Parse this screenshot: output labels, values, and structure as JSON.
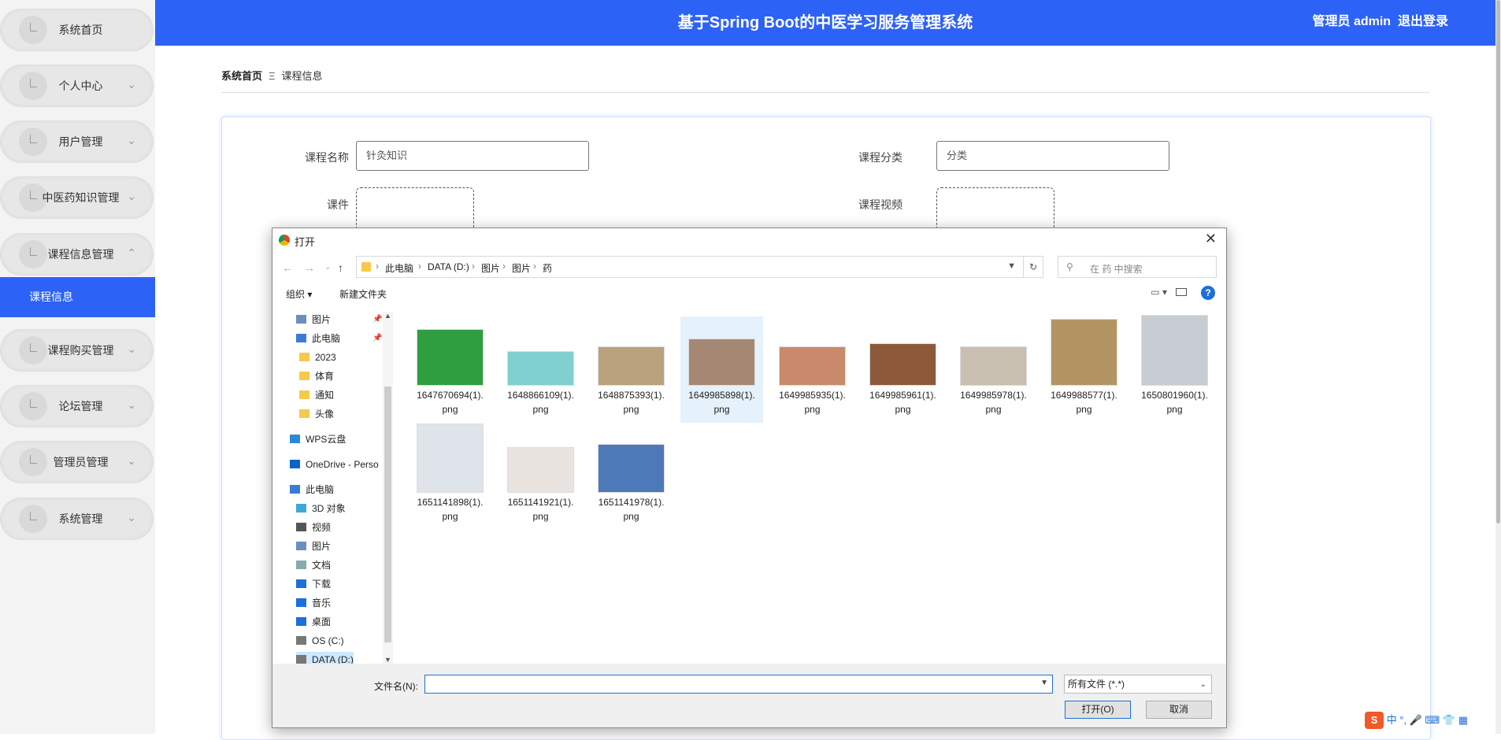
{
  "header": {
    "title": "基于Spring Boot的中医学习服务管理系统",
    "user": "管理员 admin",
    "logout": "退出登录"
  },
  "sidebar": {
    "items": [
      {
        "label": "系统首页",
        "has_chevron": false
      },
      {
        "label": "个人中心",
        "has_chevron": true
      },
      {
        "label": "用户管理",
        "has_chevron": true
      },
      {
        "label": "中医药知识管理",
        "has_chevron": true
      },
      {
        "label": "课程信息管理",
        "has_chevron": true,
        "expanded": true
      },
      {
        "label": "课程购买管理",
        "has_chevron": true
      },
      {
        "label": "论坛管理",
        "has_chevron": true
      },
      {
        "label": "管理员管理",
        "has_chevron": true
      },
      {
        "label": "系统管理",
        "has_chevron": true
      }
    ],
    "active_sub": "课程信息"
  },
  "breadcrumb": {
    "home": "系统首页",
    "separator": "Ξ",
    "current": "课程信息"
  },
  "form": {
    "course_name_label": "课程名称",
    "course_name_value": "针灸知识",
    "category_label": "课程分类",
    "category_value": "分类",
    "courseware_label": "课件",
    "video_label": "课程视频"
  },
  "dialog": {
    "title": "打开",
    "path": [
      "此电脑",
      "DATA (D:)",
      "图片",
      "图片",
      "药"
    ],
    "search_placeholder": "在 药 中搜索",
    "organize": "组织 ▾",
    "new_folder": "新建文件夹",
    "tree": [
      {
        "label": "图片",
        "icon": "pictures-icon",
        "pinned": true
      },
      {
        "label": "此电脑",
        "icon": "pc-icon",
        "pinned": true
      },
      {
        "label": "2023",
        "icon": "folder-icon"
      },
      {
        "label": "体育",
        "icon": "folder-icon"
      },
      {
        "label": "通知",
        "icon": "folder-icon"
      },
      {
        "label": "头像",
        "icon": "folder-icon"
      },
      {
        "label": "WPS云盘",
        "icon": "cloud-icon"
      },
      {
        "label": "OneDrive - Perso",
        "icon": "onedrive-icon"
      },
      {
        "label": "此电脑",
        "icon": "pc-icon"
      },
      {
        "label": "3D 对象",
        "icon": "3d-objects-icon"
      },
      {
        "label": "视频",
        "icon": "videos-icon"
      },
      {
        "label": "图片",
        "icon": "pictures-icon"
      },
      {
        "label": "文档",
        "icon": "documents-icon"
      },
      {
        "label": "下载",
        "icon": "download-icon"
      },
      {
        "label": "音乐",
        "icon": "music-icon"
      },
      {
        "label": "桌面",
        "icon": "desktop-icon"
      },
      {
        "label": "OS (C:)",
        "icon": "drive-icon"
      },
      {
        "label": "DATA (D:)",
        "icon": "drive-icon"
      }
    ],
    "files": [
      {
        "name1": "1647670694(1).",
        "name2": "png",
        "color": "#2e9e3f"
      },
      {
        "name1": "1648866109(1).",
        "name2": "png",
        "color": "#7fd0cf"
      },
      {
        "name1": "1648875393(1).",
        "name2": "png",
        "color": "#b9a27c"
      },
      {
        "name1": "1649985898(1).",
        "name2": "png",
        "color": "#a48874",
        "selected": true
      },
      {
        "name1": "1649985935(1).",
        "name2": "png",
        "color": "#c88a6a"
      },
      {
        "name1": "1649985961(1).",
        "name2": "png",
        "color": "#8c5a3a"
      },
      {
        "name1": "1649985978(1).",
        "name2": "png",
        "color": "#c9bfb0"
      },
      {
        "name1": "1649988577(1).",
        "name2": "png",
        "color": "#b39563"
      },
      {
        "name1": "1650801960(1).",
        "name2": "png",
        "color": "#c8ccd3"
      },
      {
        "name1": "1651141898(1).",
        "name2": "png",
        "color": "#dfe3ea"
      },
      {
        "name1": "1651141921(1).",
        "name2": "png",
        "color": "#e9e4e0"
      },
      {
        "name1": "1651141978(1).",
        "name2": "png",
        "color": "#4d79b8"
      }
    ],
    "filename_label": "文件名(N):",
    "filename_value": "",
    "filetype": "所有文件 (*.*)",
    "open_label": "打开(O)",
    "cancel_label": "取消"
  },
  "ime": {
    "label": "中 °,"
  }
}
